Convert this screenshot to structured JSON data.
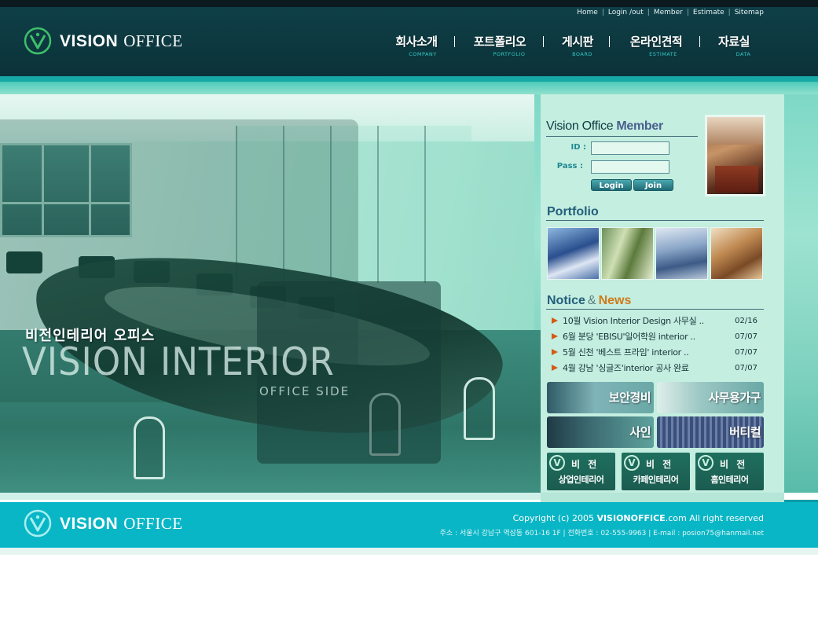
{
  "header": {
    "utility_links": [
      "Home",
      "Login /out",
      "Member",
      "Estimate",
      "Sitemap"
    ],
    "logo": {
      "word1": "VISION",
      "word2": "OFFICE"
    },
    "nav": [
      {
        "label": "회사소개",
        "sub": "COMPANY"
      },
      {
        "label": "포트폴리오",
        "sub": "PORTFOLIO"
      },
      {
        "label": "게시판",
        "sub": "BOARD"
      },
      {
        "label": "온라인견적",
        "sub": "ESTIMATE"
      },
      {
        "label": "자료실",
        "sub": "DATA"
      }
    ]
  },
  "visual": {
    "title_ko": "비전인테리어 오피스",
    "title_en": "VISION INTERIOR",
    "subtitle": "OFFICE SIDE"
  },
  "member": {
    "title_part1": "Vision Office",
    "title_part2": "Member",
    "id_label": "ID :",
    "pass_label": "Pass :",
    "id_value": "",
    "pass_value": "",
    "login_button": "Login",
    "join_button": "Join"
  },
  "portfolio": {
    "title": "Portfolio"
  },
  "notice": {
    "title_part1": "Notice",
    "title_amp": "&",
    "title_part2": "News",
    "items": [
      {
        "text": "10월 Vision Interior Design 사무실 ..",
        "date": "02/16"
      },
      {
        "text": "6월 분당 'EBISU'일어학원 interior ..",
        "date": "07/07"
      },
      {
        "text": "5월 신천 '베스트 프라임' interior ..",
        "date": "07/07"
      },
      {
        "text": "4월 강남 '싱글즈'interior 공사 완료",
        "date": "07/07"
      }
    ]
  },
  "banners": [
    {
      "label": "보안경비"
    },
    {
      "label": "사무용가구"
    },
    {
      "label": "사인"
    },
    {
      "label": "버티컬"
    }
  ],
  "vision_banners": [
    {
      "top": "비 전",
      "bottom": "상업인테리어"
    },
    {
      "top": "비 전",
      "bottom": "카페인테리어"
    },
    {
      "top": "비 전",
      "bottom": "홈인테리어"
    }
  ],
  "footer": {
    "logo": {
      "word1": "VISION",
      "word2": "OFFICE"
    },
    "copyright_pre": "Copyright (c) 2005",
    "copyright_brand": "VISIONOFFICE",
    "copyright_post": ".com All right reserved",
    "address": "주소 : 서울시 강남구 역삼동 601-16 1F  |  전화번호 : 02-555-9963  |  E-mail : posion75@hanmail.net"
  }
}
